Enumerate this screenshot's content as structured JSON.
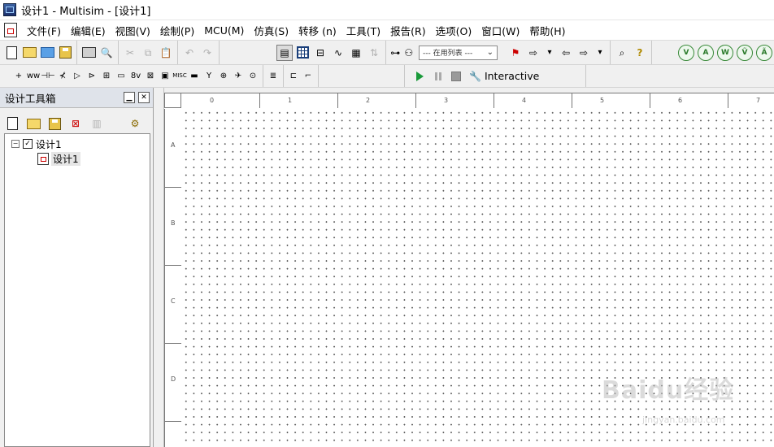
{
  "window": {
    "title": "设计1 - Multisim - [设计1]"
  },
  "menubar": {
    "items": [
      "文件(F)",
      "编辑(E)",
      "视图(V)",
      "绘制(P)",
      "MCU(M)",
      "仿真(S)",
      "转移 (n)",
      "工具(T)",
      "报告(R)",
      "选项(O)",
      "窗口(W)",
      "帮助(H)"
    ]
  },
  "toolbar": {
    "in_use_list": "--- 在用列表 ---",
    "components": [
      "+",
      "ww",
      "⊣⊢",
      "⊀",
      "▷",
      "⊳",
      "⊞",
      "▭",
      "8v",
      "⊠",
      "▣",
      "MISC",
      "▬",
      "Y",
      "⊕",
      "✈",
      "⊙",
      "≣",
      "⊏",
      "⌐"
    ],
    "instrument_buttons": [
      "V",
      "A",
      "W",
      "Ṽ",
      "Ã"
    ],
    "simulation_mode": "Interactive"
  },
  "design_toolbox": {
    "title": "设计工具箱",
    "tree": {
      "root": "设计1",
      "child": "设计1"
    }
  },
  "ruler": {
    "columns": [
      "0",
      "1",
      "2",
      "3",
      "4",
      "5",
      "6",
      "7"
    ],
    "rows": [
      "A",
      "B",
      "C",
      "D"
    ]
  },
  "watermark": {
    "text": "Baidu经验",
    "sub": "jingyan.baidu.com"
  }
}
